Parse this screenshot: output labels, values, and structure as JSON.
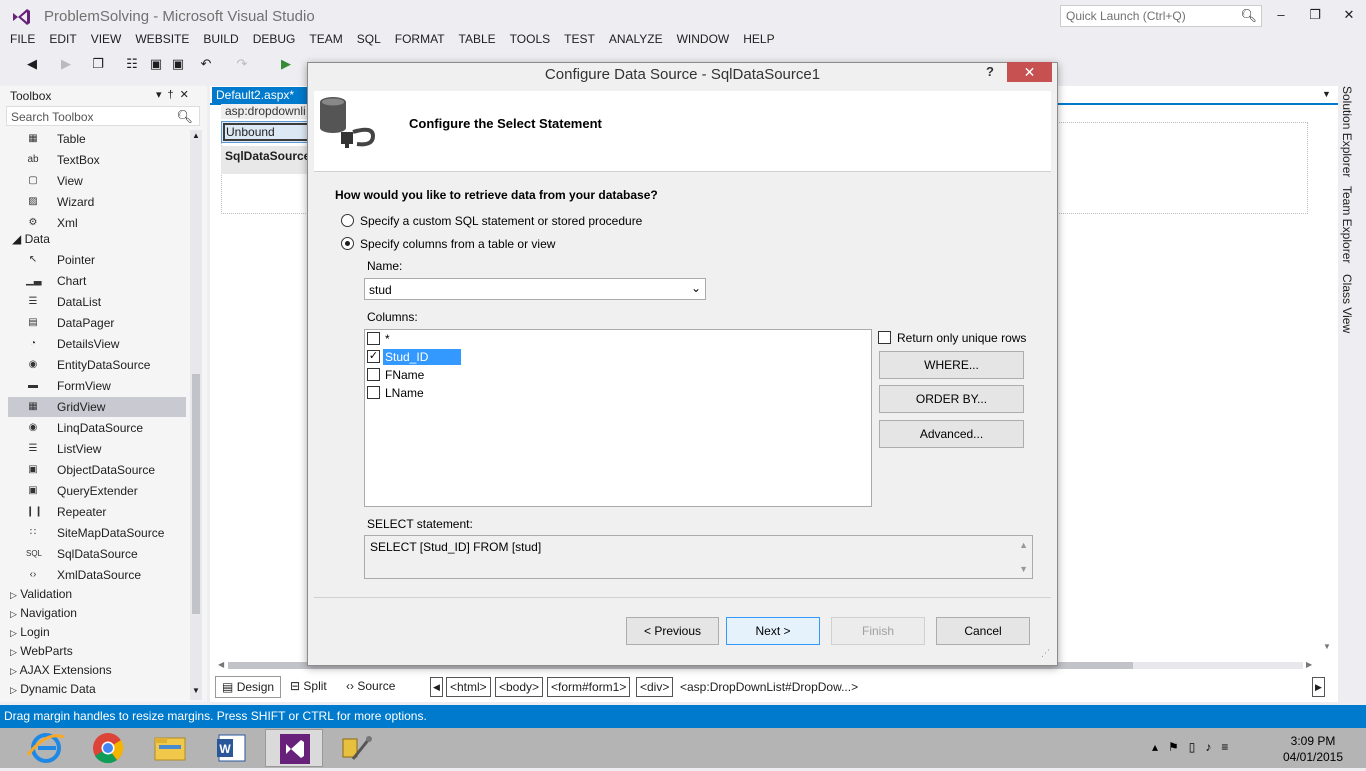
{
  "window": {
    "title": "ProblemSolving - Microsoft Visual Studio",
    "quick_launch_placeholder": "Quick Launch (Ctrl+Q)"
  },
  "menu": [
    "FILE",
    "EDIT",
    "VIEW",
    "WEBSITE",
    "BUILD",
    "DEBUG",
    "TEAM",
    "SQL",
    "FORMAT",
    "TABLE",
    "TOOLS",
    "TEST",
    "ANALYZE",
    "WINDOW",
    "HELP"
  ],
  "toolbox": {
    "title": "Toolbox",
    "search_placeholder": "Search Toolbox",
    "top_items": [
      {
        "label": "Table",
        "icon": "table-icon"
      },
      {
        "label": "TextBox",
        "icon": "textbox-icon"
      },
      {
        "label": "View",
        "icon": "view-icon"
      },
      {
        "label": "Wizard",
        "icon": "wizard-icon"
      },
      {
        "label": "Xml",
        "icon": "xml-icon"
      }
    ],
    "data_group": "Data",
    "data_items": [
      {
        "label": "Pointer",
        "icon": "pointer-icon"
      },
      {
        "label": "Chart",
        "icon": "chart-icon"
      },
      {
        "label": "DataList",
        "icon": "datalist-icon"
      },
      {
        "label": "DataPager",
        "icon": "datapager-icon"
      },
      {
        "label": "DetailsView",
        "icon": "detailsview-icon"
      },
      {
        "label": "EntityDataSource",
        "icon": "entitydatasource-icon"
      },
      {
        "label": "FormView",
        "icon": "formview-icon"
      },
      {
        "label": "GridView",
        "icon": "gridview-icon",
        "selected": true
      },
      {
        "label": "LinqDataSource",
        "icon": "linqdatasource-icon"
      },
      {
        "label": "ListView",
        "icon": "listview-icon"
      },
      {
        "label": "ObjectDataSource",
        "icon": "objectdatasource-icon"
      },
      {
        "label": "QueryExtender",
        "icon": "queryextender-icon"
      },
      {
        "label": "Repeater",
        "icon": "repeater-icon"
      },
      {
        "label": "SiteMapDataSource",
        "icon": "sitemapdatasource-icon"
      },
      {
        "label": "SqlDataSource",
        "icon": "sqldatasource-icon"
      },
      {
        "label": "XmlDataSource",
        "icon": "xmldatasource-icon"
      }
    ],
    "collapsed_groups": [
      "Validation",
      "Navigation",
      "Login",
      "WebParts",
      "AJAX Extensions",
      "Dynamic Data"
    ]
  },
  "editor": {
    "tab_label": "Default2.aspx*",
    "control_tag": "asp:dropdownli",
    "dropdown_value": "Unbound",
    "sqlds_label": "SqlDataSource",
    "view_tabs": [
      "Design",
      "Split",
      "Source"
    ],
    "breadcrumbs": [
      "<html>",
      "<body>",
      "<form#form1>",
      "<div>"
    ],
    "breadcrumb_last": "<asp:DropDownList#DropDow...>"
  },
  "side_panels": [
    "Solution Explorer",
    "Team Explorer",
    "Class View"
  ],
  "dialog": {
    "title": "Configure Data Source - SqlDataSource1",
    "help": "?",
    "header_title": "Configure the Select Statement",
    "question": "How would you like to retrieve data from your database?",
    "option_custom": "Specify a custom SQL statement or stored procedure",
    "option_columns": "Specify columns from a table or view",
    "selected_option": "columns",
    "name_label": "Name:",
    "name_value": "stud",
    "columns_label": "Columns:",
    "columns": [
      {
        "label": "*",
        "checked": false,
        "selected": false
      },
      {
        "label": "Stud_ID",
        "checked": true,
        "selected": true
      },
      {
        "label": "FName",
        "checked": false,
        "selected": false
      },
      {
        "label": "LName",
        "checked": false,
        "selected": false
      }
    ],
    "unique_rows_label": "Return only unique rows",
    "where_button": "WHERE...",
    "orderby_button": "ORDER BY...",
    "advanced_button": "Advanced...",
    "select_label": "SELECT statement:",
    "select_statement": "SELECT [Stud_ID] FROM [stud]",
    "previous_button": "< Previous",
    "next_button": "Next >",
    "finish_button": "Finish",
    "cancel_button": "Cancel"
  },
  "statusbar": {
    "message": "Drag margin handles to resize margins. Press SHIFT or CTRL for more options."
  },
  "taskbar": {
    "time": "3:09 PM",
    "date": "04/01/2015",
    "apps": [
      "internet-explorer-icon",
      "chrome-icon",
      "file-explorer-icon",
      "word-icon",
      "visual-studio-icon",
      "tools-icon"
    ]
  },
  "colors": {
    "accent": "#007acc",
    "close": "#c75050",
    "selection": "#3399ff"
  }
}
